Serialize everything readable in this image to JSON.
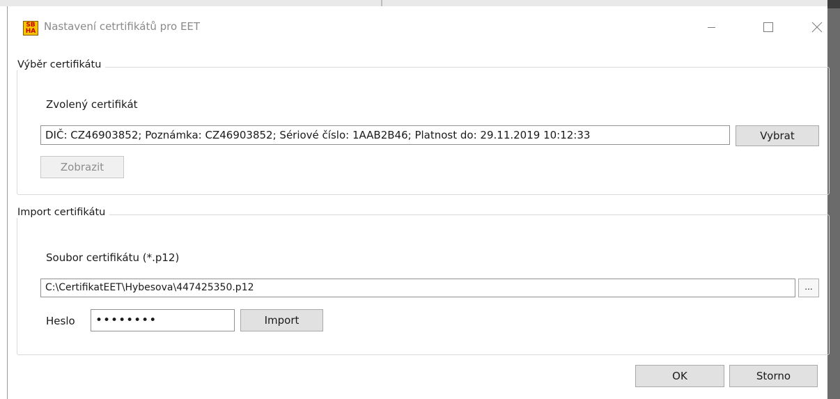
{
  "window": {
    "title": "Nastavení cetrtifikátů pro EET",
    "logo_text_top": "SB",
    "logo_text_bottom": "HA"
  },
  "selection_group": {
    "legend": "Výběr certifikátu",
    "chosen_label": "Zvolený certifikát",
    "chosen_value": "DIČ: CZ46903852; Poznámka: CZ46903852; Sériové číslo: 1AAB2B46; Platnost do: 29.11.2019 10:12:33",
    "select_button": "Vybrat",
    "show_button": "Zobrazit"
  },
  "import_group": {
    "legend": "Import certifikátu",
    "file_label": "Soubor certifikátu (*.p12)",
    "file_path": "C:\\CertifikatEET\\Hybesova\\447425350.p12",
    "browse_button": "...",
    "password_label": "Heslo",
    "password_value": "••••••••",
    "import_button": "Import"
  },
  "footer": {
    "ok_button": "OK",
    "cancel_button": "Storno"
  },
  "icons": [
    "app-logo-icon",
    "minimize-icon",
    "maximize-icon",
    "close-icon"
  ]
}
